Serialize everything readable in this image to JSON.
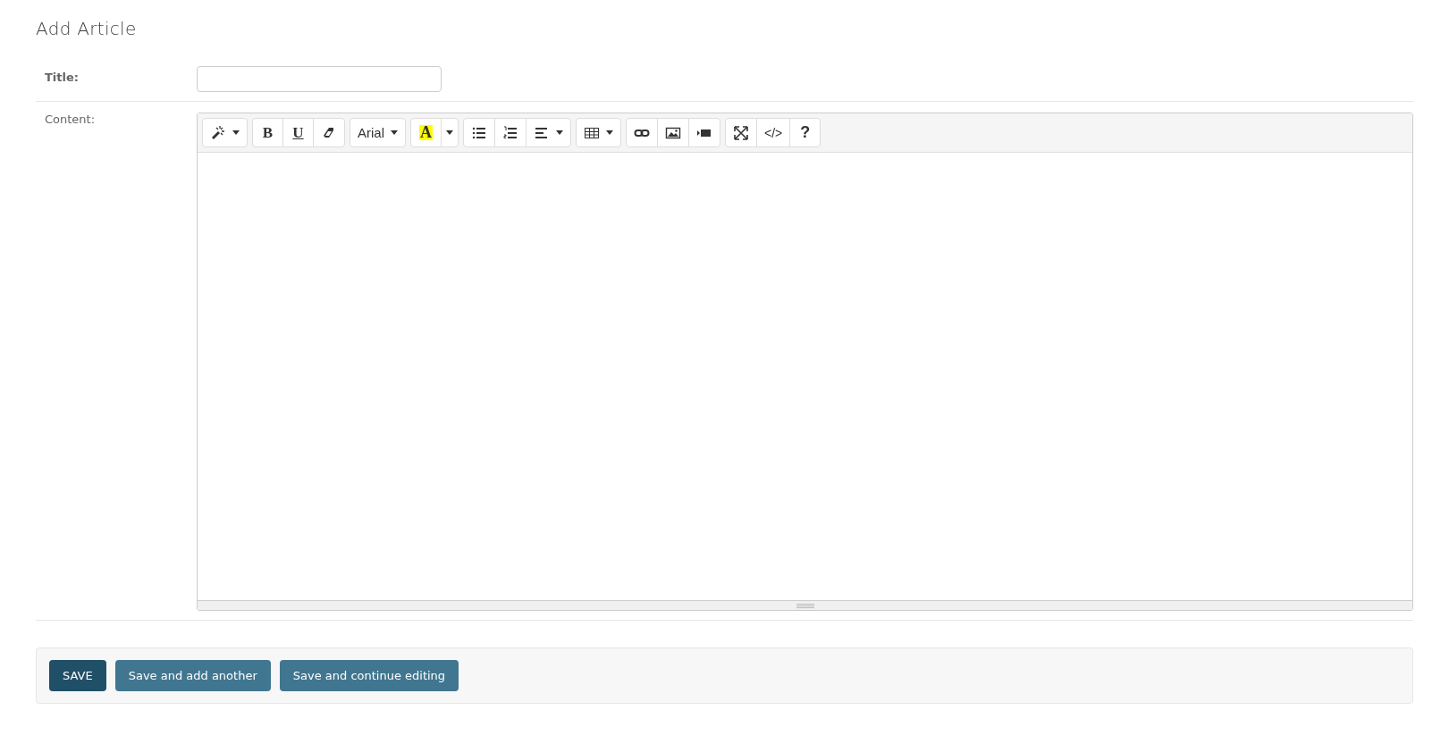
{
  "page_title": "Add Article",
  "fields": [
    {
      "label": "Title:",
      "kind": "text"
    },
    {
      "label": "Content:",
      "kind": "editor"
    }
  ],
  "toolbar": [
    [
      {
        "kind": "magic",
        "dropdown": true
      }
    ],
    [
      {
        "kind": "bold",
        "label": "B"
      },
      {
        "kind": "underline",
        "label": "U"
      },
      {
        "kind": "eraser"
      }
    ],
    [
      {
        "kind": "font",
        "label": "Arial",
        "dropdown": true
      }
    ],
    [
      {
        "kind": "color",
        "label": "A"
      },
      {
        "kind": "caret"
      }
    ],
    [
      {
        "kind": "bullets"
      },
      {
        "kind": "numbers"
      },
      {
        "kind": "align",
        "dropdown": true
      }
    ],
    [
      {
        "kind": "table",
        "dropdown": true
      }
    ],
    [
      {
        "kind": "link"
      },
      {
        "kind": "picture"
      },
      {
        "kind": "video"
      }
    ],
    [
      {
        "kind": "fullscreen"
      },
      {
        "kind": "code",
        "label": "</>"
      },
      {
        "kind": "help",
        "label": "?"
      }
    ]
  ],
  "buttons": [
    {
      "label": "SAVE",
      "kind": "primary"
    },
    {
      "label": "Save and add another",
      "kind": "secondary"
    },
    {
      "label": "Save and continue editing",
      "kind": "secondary"
    }
  ]
}
